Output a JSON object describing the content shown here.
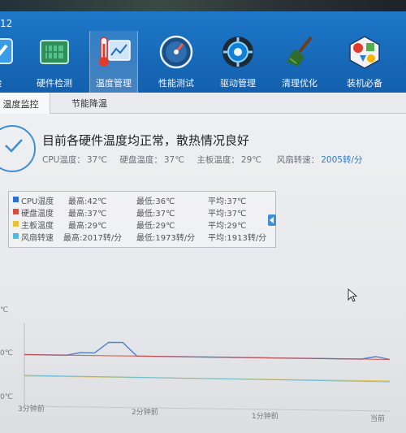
{
  "window": {
    "number": "12"
  },
  "nav": {
    "items": [
      {
        "label": "检",
        "icon": "check-icon"
      },
      {
        "label": "硬件检测",
        "icon": "hardware-card-icon"
      },
      {
        "label": "温度管理",
        "icon": "thermometer-chart-icon",
        "active": true
      },
      {
        "label": "性能测试",
        "icon": "speedometer-icon"
      },
      {
        "label": "驱动管理",
        "icon": "gear-chip-icon"
      },
      {
        "label": "清理优化",
        "icon": "broom-icon"
      },
      {
        "label": "装机必备",
        "icon": "cube-apps-icon"
      }
    ]
  },
  "tabs": [
    {
      "label": "温度监控",
      "active": true
    },
    {
      "label": "节能降温"
    }
  ],
  "status": {
    "title": "目前各硬件温度均正常，散热情况良好",
    "cpu_label": "CPU温度：",
    "cpu_value": "37℃",
    "hdd_label": "硬盘温度：",
    "hdd_value": "37℃",
    "board_label": "主板温度：",
    "board_value": "29℃",
    "fan_label": "风扇转速：",
    "fan_value": "2005转/分"
  },
  "legend": [
    {
      "name": "CPU温度",
      "max": "最高:42℃",
      "min": "最低:36℃",
      "avg": "平均:37℃",
      "color": "#2e6fd0"
    },
    {
      "name": "硬盘温度",
      "max": "最高:37℃",
      "min": "最低:37℃",
      "avg": "平均:37℃",
      "color": "#d94b3a"
    },
    {
      "name": "主板温度",
      "max": "最高:29℃",
      "min": "最低:29℃",
      "avg": "平均:29℃",
      "color": "#e8c23a"
    },
    {
      "name": "风扇转速",
      "max": "最高:2017转/分",
      "min": "最低:1973转/分",
      "avg": "平均:1913转/分",
      "color": "#53b8e0"
    }
  ],
  "chart": {
    "y_ticks": [
      "℃",
      "0℃",
      "0℃"
    ],
    "x_ticks": [
      "3分钟前",
      "2分钟前",
      "1分钟前",
      "当前"
    ]
  },
  "chart_data": {
    "type": "line",
    "series": [
      {
        "name": "CPU温度",
        "values": [
          37,
          37,
          37,
          37,
          38,
          38,
          42,
          42,
          37,
          37,
          37,
          37,
          37,
          37,
          37,
          37,
          37,
          37,
          37,
          37,
          37,
          37,
          37,
          37,
          37,
          38,
          37
        ]
      },
      {
        "name": "硬盘温度",
        "values": [
          37,
          37,
          37,
          37,
          37,
          37,
          37,
          37,
          37,
          37,
          37,
          37,
          37,
          37,
          37,
          37,
          37,
          37,
          37,
          37,
          37,
          37,
          37,
          37,
          37,
          37,
          37
        ]
      },
      {
        "name": "主板温度",
        "values": [
          29,
          29,
          29,
          29,
          29,
          29,
          29,
          29,
          29,
          29,
          29,
          29,
          29,
          29,
          29,
          29,
          29,
          29,
          29,
          29,
          29,
          29,
          29,
          29,
          29,
          29,
          29
        ]
      },
      {
        "name": "风扇转速",
        "values": []
      }
    ],
    "x_ticks": [
      "3分钟前",
      "2分钟前",
      "1分钟前",
      "当前"
    ]
  }
}
